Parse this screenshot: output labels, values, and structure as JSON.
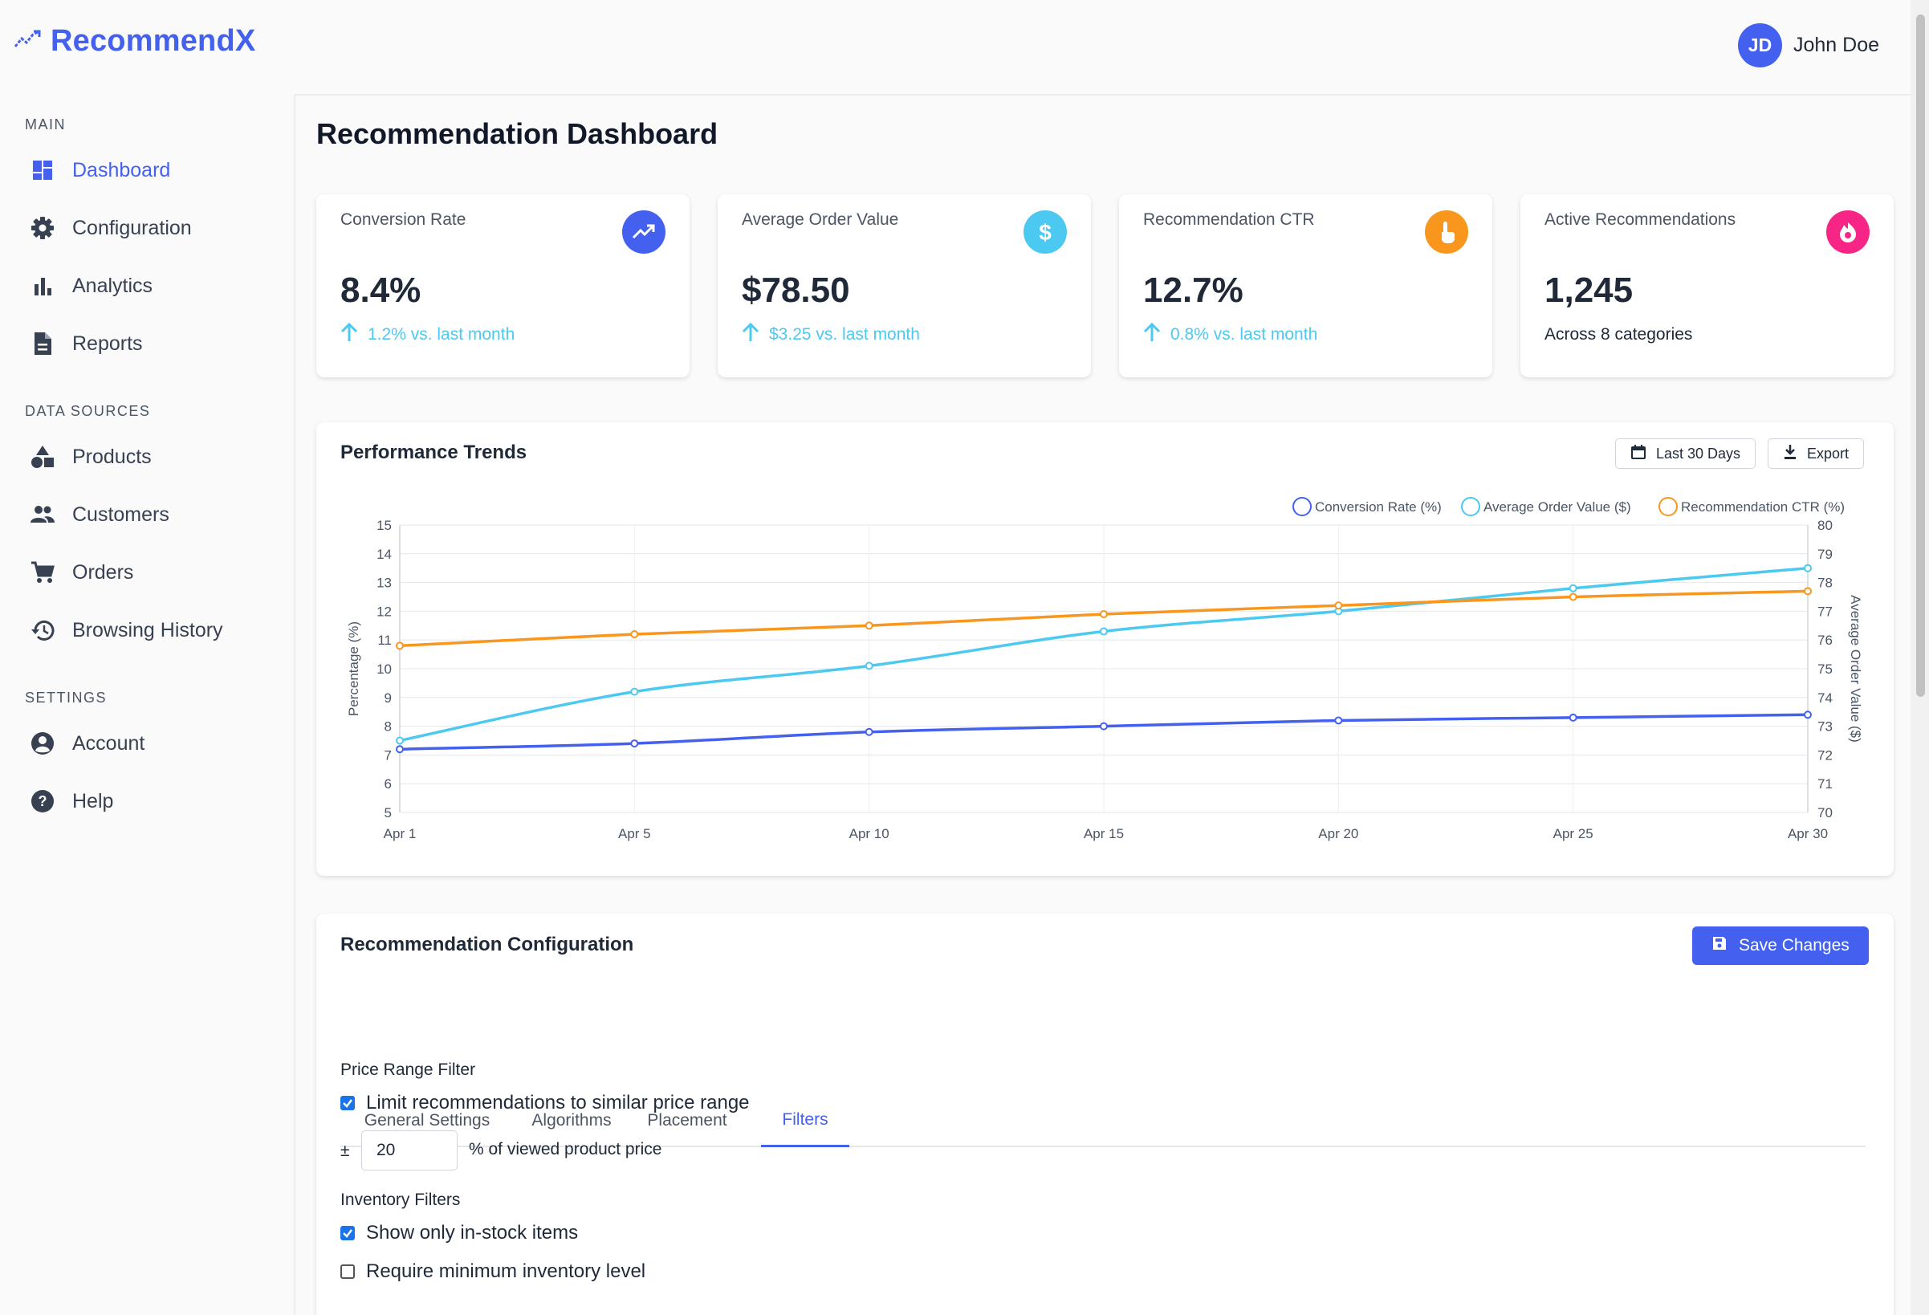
{
  "app": {
    "name": "RecommendX"
  },
  "user": {
    "initials": "JD",
    "name": "John Doe"
  },
  "sidebar": {
    "sections": [
      {
        "title": "MAIN",
        "items": [
          {
            "label": "Dashboard",
            "icon": "dashboard-icon",
            "active": true
          },
          {
            "label": "Configuration",
            "icon": "gear-icon"
          },
          {
            "label": "Analytics",
            "icon": "bar-chart-icon"
          },
          {
            "label": "Reports",
            "icon": "document-icon"
          }
        ]
      },
      {
        "title": "DATA SOURCES",
        "items": [
          {
            "label": "Products",
            "icon": "shapes-icon"
          },
          {
            "label": "Customers",
            "icon": "people-icon"
          },
          {
            "label": "Orders",
            "icon": "cart-icon"
          },
          {
            "label": "Browsing History",
            "icon": "history-icon"
          }
        ]
      },
      {
        "title": "SETTINGS",
        "items": [
          {
            "label": "Account",
            "icon": "account-icon"
          },
          {
            "label": "Help",
            "icon": "help-icon"
          }
        ]
      }
    ]
  },
  "page": {
    "title": "Recommendation Dashboard"
  },
  "stats": [
    {
      "label": "Conversion Rate",
      "value": "8.4%",
      "trend": "1.2% vs. last month",
      "icon": "trending-up-icon",
      "color": "#4361ee"
    },
    {
      "label": "Average Order Value",
      "value": "$78.50",
      "trend": "$3.25 vs. last month",
      "icon": "dollar-icon",
      "color": "#4cc9f0"
    },
    {
      "label": "Recommendation CTR",
      "value": "12.7%",
      "trend": "0.8% vs. last month",
      "icon": "pointer-icon",
      "color": "#f8961e"
    },
    {
      "label": "Active Recommendations",
      "value": "1,245",
      "sub": "Across 8 categories",
      "icon": "fire-icon",
      "color": "#f72585"
    }
  ],
  "performance": {
    "title": "Performance Trends",
    "date_button": "Last 30 Days",
    "export_button": "Export"
  },
  "chart_data": {
    "type": "line",
    "x": [
      "Apr 1",
      "Apr 5",
      "Apr 10",
      "Apr 15",
      "Apr 20",
      "Apr 25",
      "Apr 30"
    ],
    "series": [
      {
        "name": "Conversion Rate (%)",
        "axis": "left",
        "color": "#4361ee",
        "values": [
          7.2,
          7.4,
          7.8,
          8.0,
          8.2,
          8.3,
          8.4
        ]
      },
      {
        "name": "Average Order Value ($)",
        "axis": "right",
        "color": "#4cc9f0",
        "values": [
          72.5,
          74.2,
          75.1,
          76.3,
          77.0,
          77.8,
          78.5
        ]
      },
      {
        "name": "Recommendation CTR (%)",
        "axis": "left",
        "color": "#f8961e",
        "values": [
          10.8,
          11.2,
          11.5,
          11.9,
          12.2,
          12.5,
          12.7
        ]
      }
    ],
    "ylabel": "Percentage (%)",
    "y2label": "Average Order Value ($)",
    "ylim": [
      5,
      15
    ],
    "y2lim": [
      70,
      80
    ],
    "yticks": [
      "5",
      "6",
      "7",
      "8",
      "9",
      "10",
      "11",
      "12",
      "13",
      "14",
      "15"
    ],
    "y2ticks": [
      "70",
      "71",
      "72",
      "73",
      "74",
      "75",
      "76",
      "77",
      "78",
      "79",
      "80"
    ],
    "legend": "top-right",
    "grid": true
  },
  "config": {
    "title": "Recommendation Configuration",
    "save_label": "Save Changes",
    "tabs": [
      "General Settings",
      "Algorithms",
      "Placement",
      "Filters"
    ],
    "active_tab": "Filters",
    "price_filter_label": "Price Range Filter",
    "price_checkbox_label": "Limit recommendations to similar price range",
    "price_checked": true,
    "plus_minus": "±",
    "price_value": "20",
    "price_suffix": "% of viewed product price",
    "inventory_label": "Inventory Filters",
    "instock_label": "Show only in-stock items",
    "instock_checked": true,
    "min_inventory_label": "Require minimum inventory level",
    "min_inventory_checked": false
  }
}
